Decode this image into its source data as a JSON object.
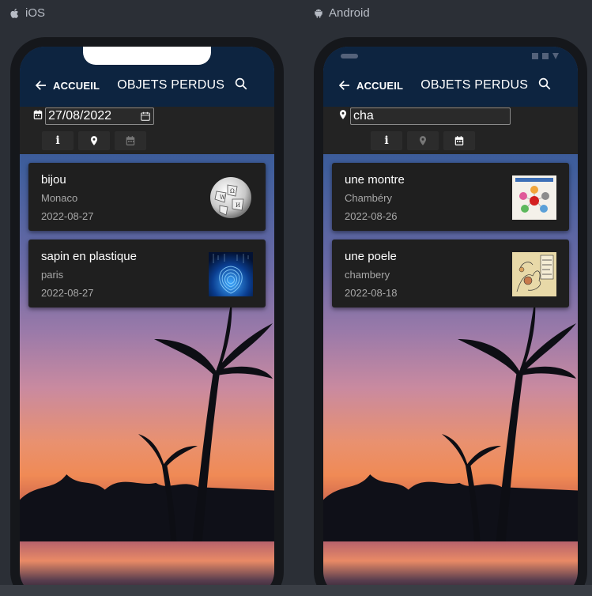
{
  "platforms": [
    {
      "label": "iOS",
      "icon": "apple-icon",
      "appbar": {
        "back_label": "ACCUEIL",
        "title": "OBJETS PERDUS"
      },
      "filter": {
        "icon": "calendar-icon",
        "value": "27/08/2022",
        "type": "date"
      },
      "tabs": [
        {
          "icon": "info-icon",
          "active": true
        },
        {
          "icon": "map-marker-icon",
          "active": true
        },
        {
          "icon": "calendar-icon",
          "active": false
        }
      ],
      "items": [
        {
          "title": "bijou",
          "city": "Monaco",
          "date": "2022-08-27",
          "thumb": "wikipedia-globe-image"
        },
        {
          "title": "sapin en plastique",
          "city": "paris",
          "date": "2022-08-27",
          "thumb": "blue-fingerprint-image"
        }
      ]
    },
    {
      "label": "Android",
      "icon": "android-icon",
      "appbar": {
        "back_label": "ACCUEIL",
        "title": "OBJETS PERDUS"
      },
      "filter": {
        "icon": "map-marker-icon",
        "value": "cha",
        "type": "text"
      },
      "tabs": [
        {
          "icon": "info-icon",
          "active": true
        },
        {
          "icon": "map-marker-icon",
          "active": false
        },
        {
          "icon": "calendar-icon",
          "active": true
        }
      ],
      "items": [
        {
          "title": "une montre",
          "city": "Chambéry",
          "date": "2022-08-26",
          "thumb": "colorful-diagram-image"
        },
        {
          "title": "une poele",
          "city": "chambery",
          "date": "2022-08-18",
          "thumb": "comic-illustration-image"
        }
      ]
    }
  ],
  "colors": {
    "appbar": "#0d2440",
    "filterbar": "#232323",
    "card": "#1f1f1f",
    "page_bg": "#2b2f36"
  }
}
